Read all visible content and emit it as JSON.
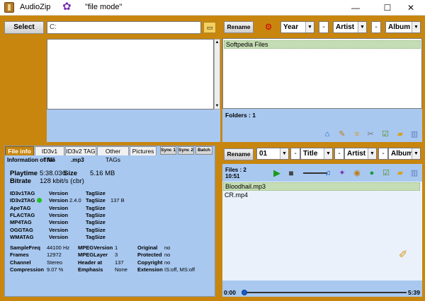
{
  "window": {
    "app_title": "AudioZip",
    "mode_label": "\"file mode\"",
    "minimize": "—",
    "maximize": "☐",
    "close": "✕"
  },
  "left_top": {
    "select_button": "Select",
    "path_value": "C:"
  },
  "right_top": {
    "rename_button": "Rename",
    "selectors": [
      "Year",
      "Artist",
      "Album"
    ],
    "dash": "-",
    "files": [
      "Softpedia Files"
    ],
    "folders_label": "Folders : 1"
  },
  "right_bottom": {
    "rename_button": "Rename",
    "selectors": [
      "01",
      "Title",
      "Artist",
      "Album"
    ],
    "dash": "-",
    "files_count": "Files : 2",
    "duration": "10:51",
    "files": [
      "Bloodhail.mp3",
      "CR.mp4"
    ],
    "time_start": "0:00",
    "time_end": "5:39",
    "progress": 0.0
  },
  "info_panel": {
    "tabs": [
      "File info",
      "ID3v1 TAG",
      "ID3v2 TAG",
      "Other TAGs",
      "Pictures"
    ],
    "active_tab": "File info",
    "sync_buttons": [
      "Sync 1",
      "Sync 2",
      "Batch"
    ],
    "info_of_file_label": "Information of file",
    "info_of_file_value": ".mp3",
    "playtime_label": "Playtime",
    "playtime_value": "5:38.036",
    "size_label": "Size",
    "size_value": "5.16 MB",
    "bitrate_label": "Bitrate",
    "bitrate_value": "128 kbit/s (cbr)",
    "tag_rows": [
      {
        "name": "ID3v1TAG",
        "version": "Version",
        "version_val": "",
        "tagsize": "TagSize",
        "tagsize_val": "",
        "present": false
      },
      {
        "name": "ID3v2TAG",
        "version": "Version",
        "version_val": "2.4.0",
        "tagsize": "TagSize",
        "tagsize_val": "137 B",
        "present": true
      },
      {
        "name": "ApeTAG",
        "version": "Version",
        "version_val": "",
        "tagsize": "TagSize",
        "tagsize_val": "",
        "present": false
      },
      {
        "name": "FLACTAG",
        "version": "Version",
        "version_val": "",
        "tagsize": "TagSize",
        "tagsize_val": "",
        "present": false
      },
      {
        "name": "MP4TAG",
        "version": "Version",
        "version_val": "",
        "tagsize": "TagSize",
        "tagsize_val": "",
        "present": false
      },
      {
        "name": "OGGTAG",
        "version": "Version",
        "version_val": "",
        "tagsize": "TagSize",
        "tagsize_val": "",
        "present": false
      },
      {
        "name": "WMATAG",
        "version": "Version",
        "version_val": "",
        "tagsize": "TagSize",
        "tagsize_val": "",
        "present": false
      }
    ],
    "tech": [
      {
        "l1": "SampleFreq",
        "v1": "44100 Hz",
        "l2": "MPEGVersion",
        "v2": "1",
        "l3": "Original",
        "v3": "no"
      },
      {
        "l1": "Frames",
        "v1": "12972",
        "l2": "MPEGLayer",
        "v2": "3",
        "l3": "Protected",
        "v3": "no"
      },
      {
        "l1": "Channel",
        "v1": "Stereo",
        "l2": "Header at",
        "v2": "137",
        "l3": "Copyright",
        "v3": "no"
      },
      {
        "l1": "Compression",
        "v1": "9.07 %",
        "l2": "Emphasis",
        "v2": "None",
        "l3": "Extension",
        "v3": "IS:off, MS:off"
      }
    ]
  },
  "colors": {
    "frame": "#c8860f",
    "panel": "#a8c8f0",
    "selected_row": "#c5ddb4",
    "present_dot": "#22c022"
  }
}
